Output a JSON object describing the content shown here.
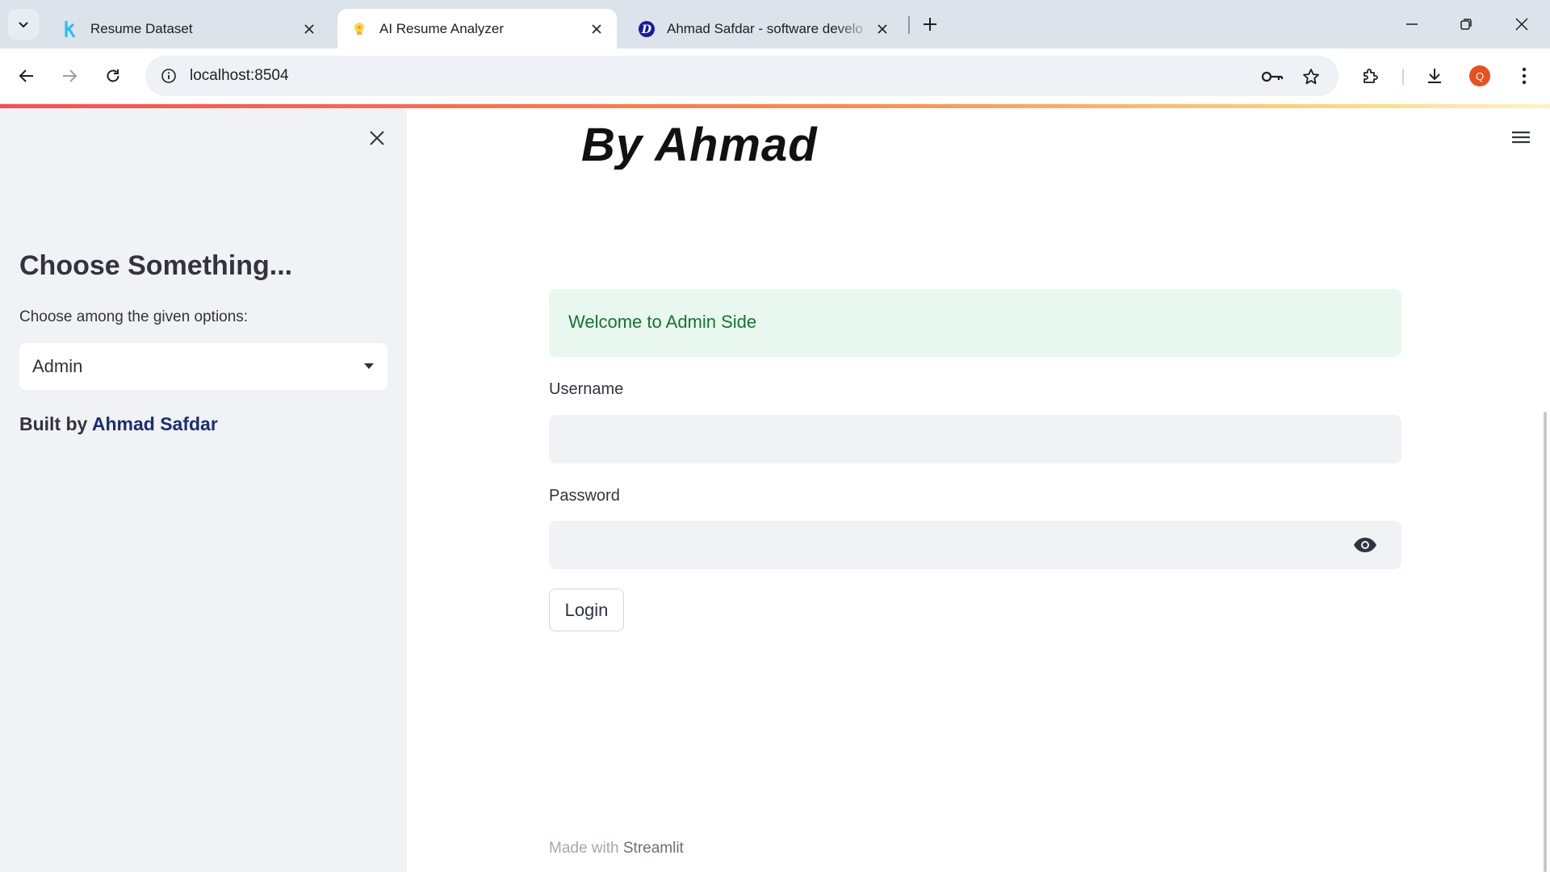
{
  "browser": {
    "tabs": [
      {
        "title": "Resume Dataset",
        "favicon": "kaggle-k-icon",
        "active": false
      },
      {
        "title": "AI Resume Analyzer",
        "favicon": "streamlit-bulb-icon",
        "active": true
      },
      {
        "title": "Ahmad Safdar - software develo",
        "favicon": "d-logo-icon",
        "active": false
      }
    ],
    "url": "localhost:8504",
    "profile_initial": "Q"
  },
  "sidebar": {
    "heading": "Choose Something...",
    "select_label": "Choose among the given options:",
    "selected_option": "Admin",
    "built_by_prefix": "Built by ",
    "built_by_name": "Ahmad Safdar"
  },
  "main": {
    "clipped_heading": "By Ahmad Safdar",
    "success_message": "Welcome to Admin Side",
    "username_label": "Username",
    "username_value": "",
    "password_label": "Password",
    "password_value": "",
    "login_button": "Login",
    "footer_prefix": "Made with ",
    "footer_brand": "Streamlit"
  },
  "colors": {
    "accent": "#ff4b4b",
    "sidebar_bg": "#f0f2f6",
    "success_bg": "#e8f8ee",
    "success_text": "#177233",
    "link": "#1a2e6e"
  }
}
